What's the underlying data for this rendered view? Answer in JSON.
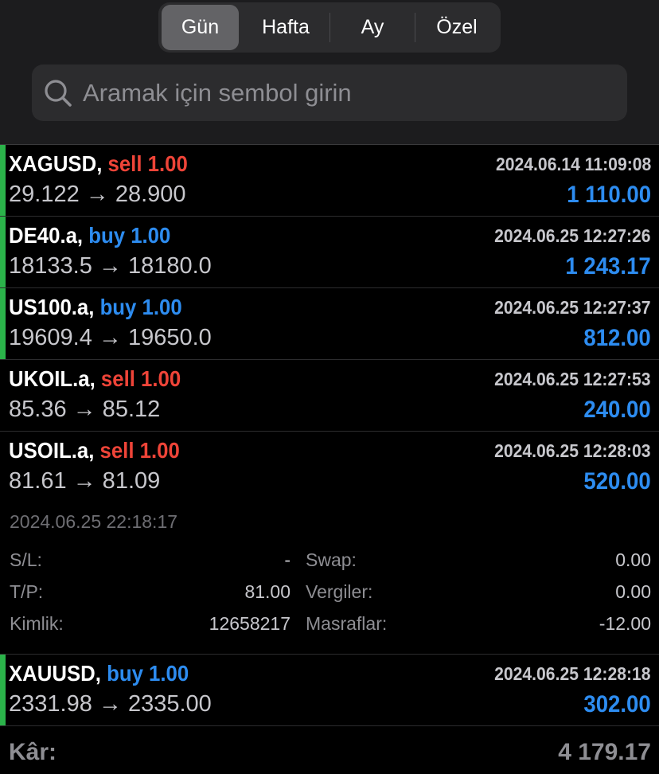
{
  "tabs": [
    {
      "label": "Gün",
      "active": true
    },
    {
      "label": "Hafta",
      "active": false
    },
    {
      "label": "Ay",
      "active": false
    },
    {
      "label": "Özel",
      "active": false
    }
  ],
  "search": {
    "placeholder": "Aramak için sembol girin",
    "icon": "search-icon"
  },
  "trades": [
    {
      "symbol": "XAGUSD,",
      "side": "sell",
      "volume": "1.00",
      "time": "2024.06.14 11:09:08",
      "prices": "29.122 → 28.900",
      "profit": "1 110.00"
    },
    {
      "symbol": "DE40.a,",
      "side": "buy",
      "volume": "1.00",
      "time": "2024.06.25 12:27:26",
      "prices": "18133.5 → 18180.0",
      "profit": "1 243.17"
    },
    {
      "symbol": "US100.a,",
      "side": "buy",
      "volume": "1.00",
      "time": "2024.06.25 12:27:37",
      "prices": "19609.4 → 19650.0",
      "profit": "812.00"
    },
    {
      "symbol": "UKOIL.a,",
      "side": "sell",
      "volume": "1.00",
      "time": "2024.06.25 12:27:53",
      "prices": "85.36 → 85.12",
      "profit": "240.00"
    },
    {
      "symbol": "USOIL.a,",
      "side": "sell",
      "volume": "1.00",
      "time": "2024.06.25 12:28:03",
      "prices": "81.61 → 81.09",
      "profit": "520.00"
    },
    {
      "symbol": "XAUUSD,",
      "side": "buy",
      "volume": "1.00",
      "time": "2024.06.25 12:28:18",
      "prices": "2331.98 → 2335.00",
      "profit": "302.00"
    }
  ],
  "detail": {
    "close_time": "2024.06.25 22:18:17",
    "sl_label": "S/L:",
    "sl_value": "-",
    "tp_label": "T/P:",
    "tp_value": "81.00",
    "id_label": "Kimlik:",
    "id_value": "12658217",
    "swap_label": "Swap:",
    "swap_value": "0.00",
    "tax_label": "Vergiler:",
    "tax_value": "0.00",
    "fee_label": "Masraflar:",
    "fee_value": "-12.00"
  },
  "footer": {
    "label": "Kâr:",
    "value": "4 179.17"
  },
  "colors": {
    "sell": "#ee4438",
    "buy": "#2d8cf0",
    "indicator": "#2bb34a",
    "background": "#000000"
  }
}
